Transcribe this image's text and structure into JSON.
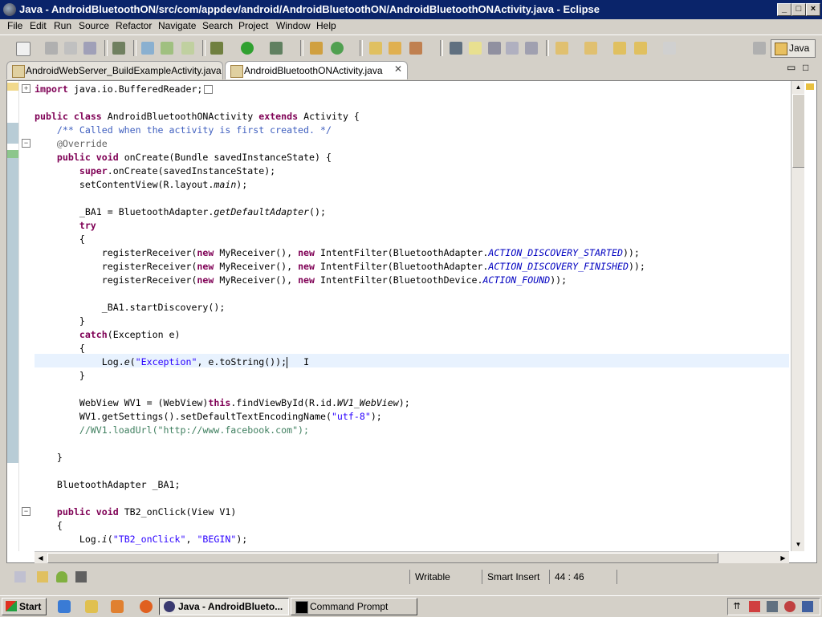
{
  "window": {
    "title": "Java - AndroidBluetoothON/src/com/appdev/android/AndroidBluetoothON/AndroidBluetoothONActivity.java - Eclipse"
  },
  "menu": [
    "File",
    "Edit",
    "Run",
    "Source",
    "Refactor",
    "Navigate",
    "Search",
    "Project",
    "Window",
    "Help"
  ],
  "perspective": {
    "label": "Java"
  },
  "tabs": [
    {
      "label": "AndroidWebServer_BuildExampleActivity.java",
      "active": false
    },
    {
      "label": "AndroidBluetoothONActivity.java",
      "active": true
    }
  ],
  "code_lines": [
    "import java.io.BufferedReader;",
    "",
    "public class AndroidBluetoothONActivity extends Activity {",
    "    /** Called when the activity is first created. */",
    "    @Override",
    "    public void onCreate(Bundle savedInstanceState) {",
    "        super.onCreate(savedInstanceState);",
    "        setContentView(R.layout.main);",
    "",
    "        _BA1 = BluetoothAdapter.getDefaultAdapter();",
    "        try",
    "        {",
    "            registerReceiver(new MyReceiver(), new IntentFilter(BluetoothAdapter.ACTION_DISCOVERY_STARTED));",
    "            registerReceiver(new MyReceiver(), new IntentFilter(BluetoothAdapter.ACTION_DISCOVERY_FINISHED));",
    "            registerReceiver(new MyReceiver(), new IntentFilter(BluetoothDevice.ACTION_FOUND));",
    "",
    "            _BA1.startDiscovery();",
    "        }",
    "        catch(Exception e)",
    "        {",
    "            Log.e(\"Exception\", e.toString());",
    "        }",
    "",
    "        WebView WV1 = (WebView)this.findViewById(R.id.WV1_WebView);",
    "        WV1.getSettings().setDefaultTextEncodingName(\"utf-8\");",
    "        //WV1.loadUrl(\"http://www.facebook.com\");",
    "",
    "    }",
    "",
    "    BluetoothAdapter _BA1;",
    "",
    "    public void TB2_onClick(View V1)",
    "    {",
    "        Log.i(\"TB2_onClick\", \"BEGIN\");"
  ],
  "status": {
    "writable": "Writable",
    "insert_mode": "Smart Insert",
    "position": "44 : 46"
  },
  "taskbar": {
    "start": "Start",
    "tasks": [
      {
        "label": "Java - AndroidBlueto...",
        "active": true
      },
      {
        "label": "Command Prompt",
        "active": false
      }
    ]
  }
}
